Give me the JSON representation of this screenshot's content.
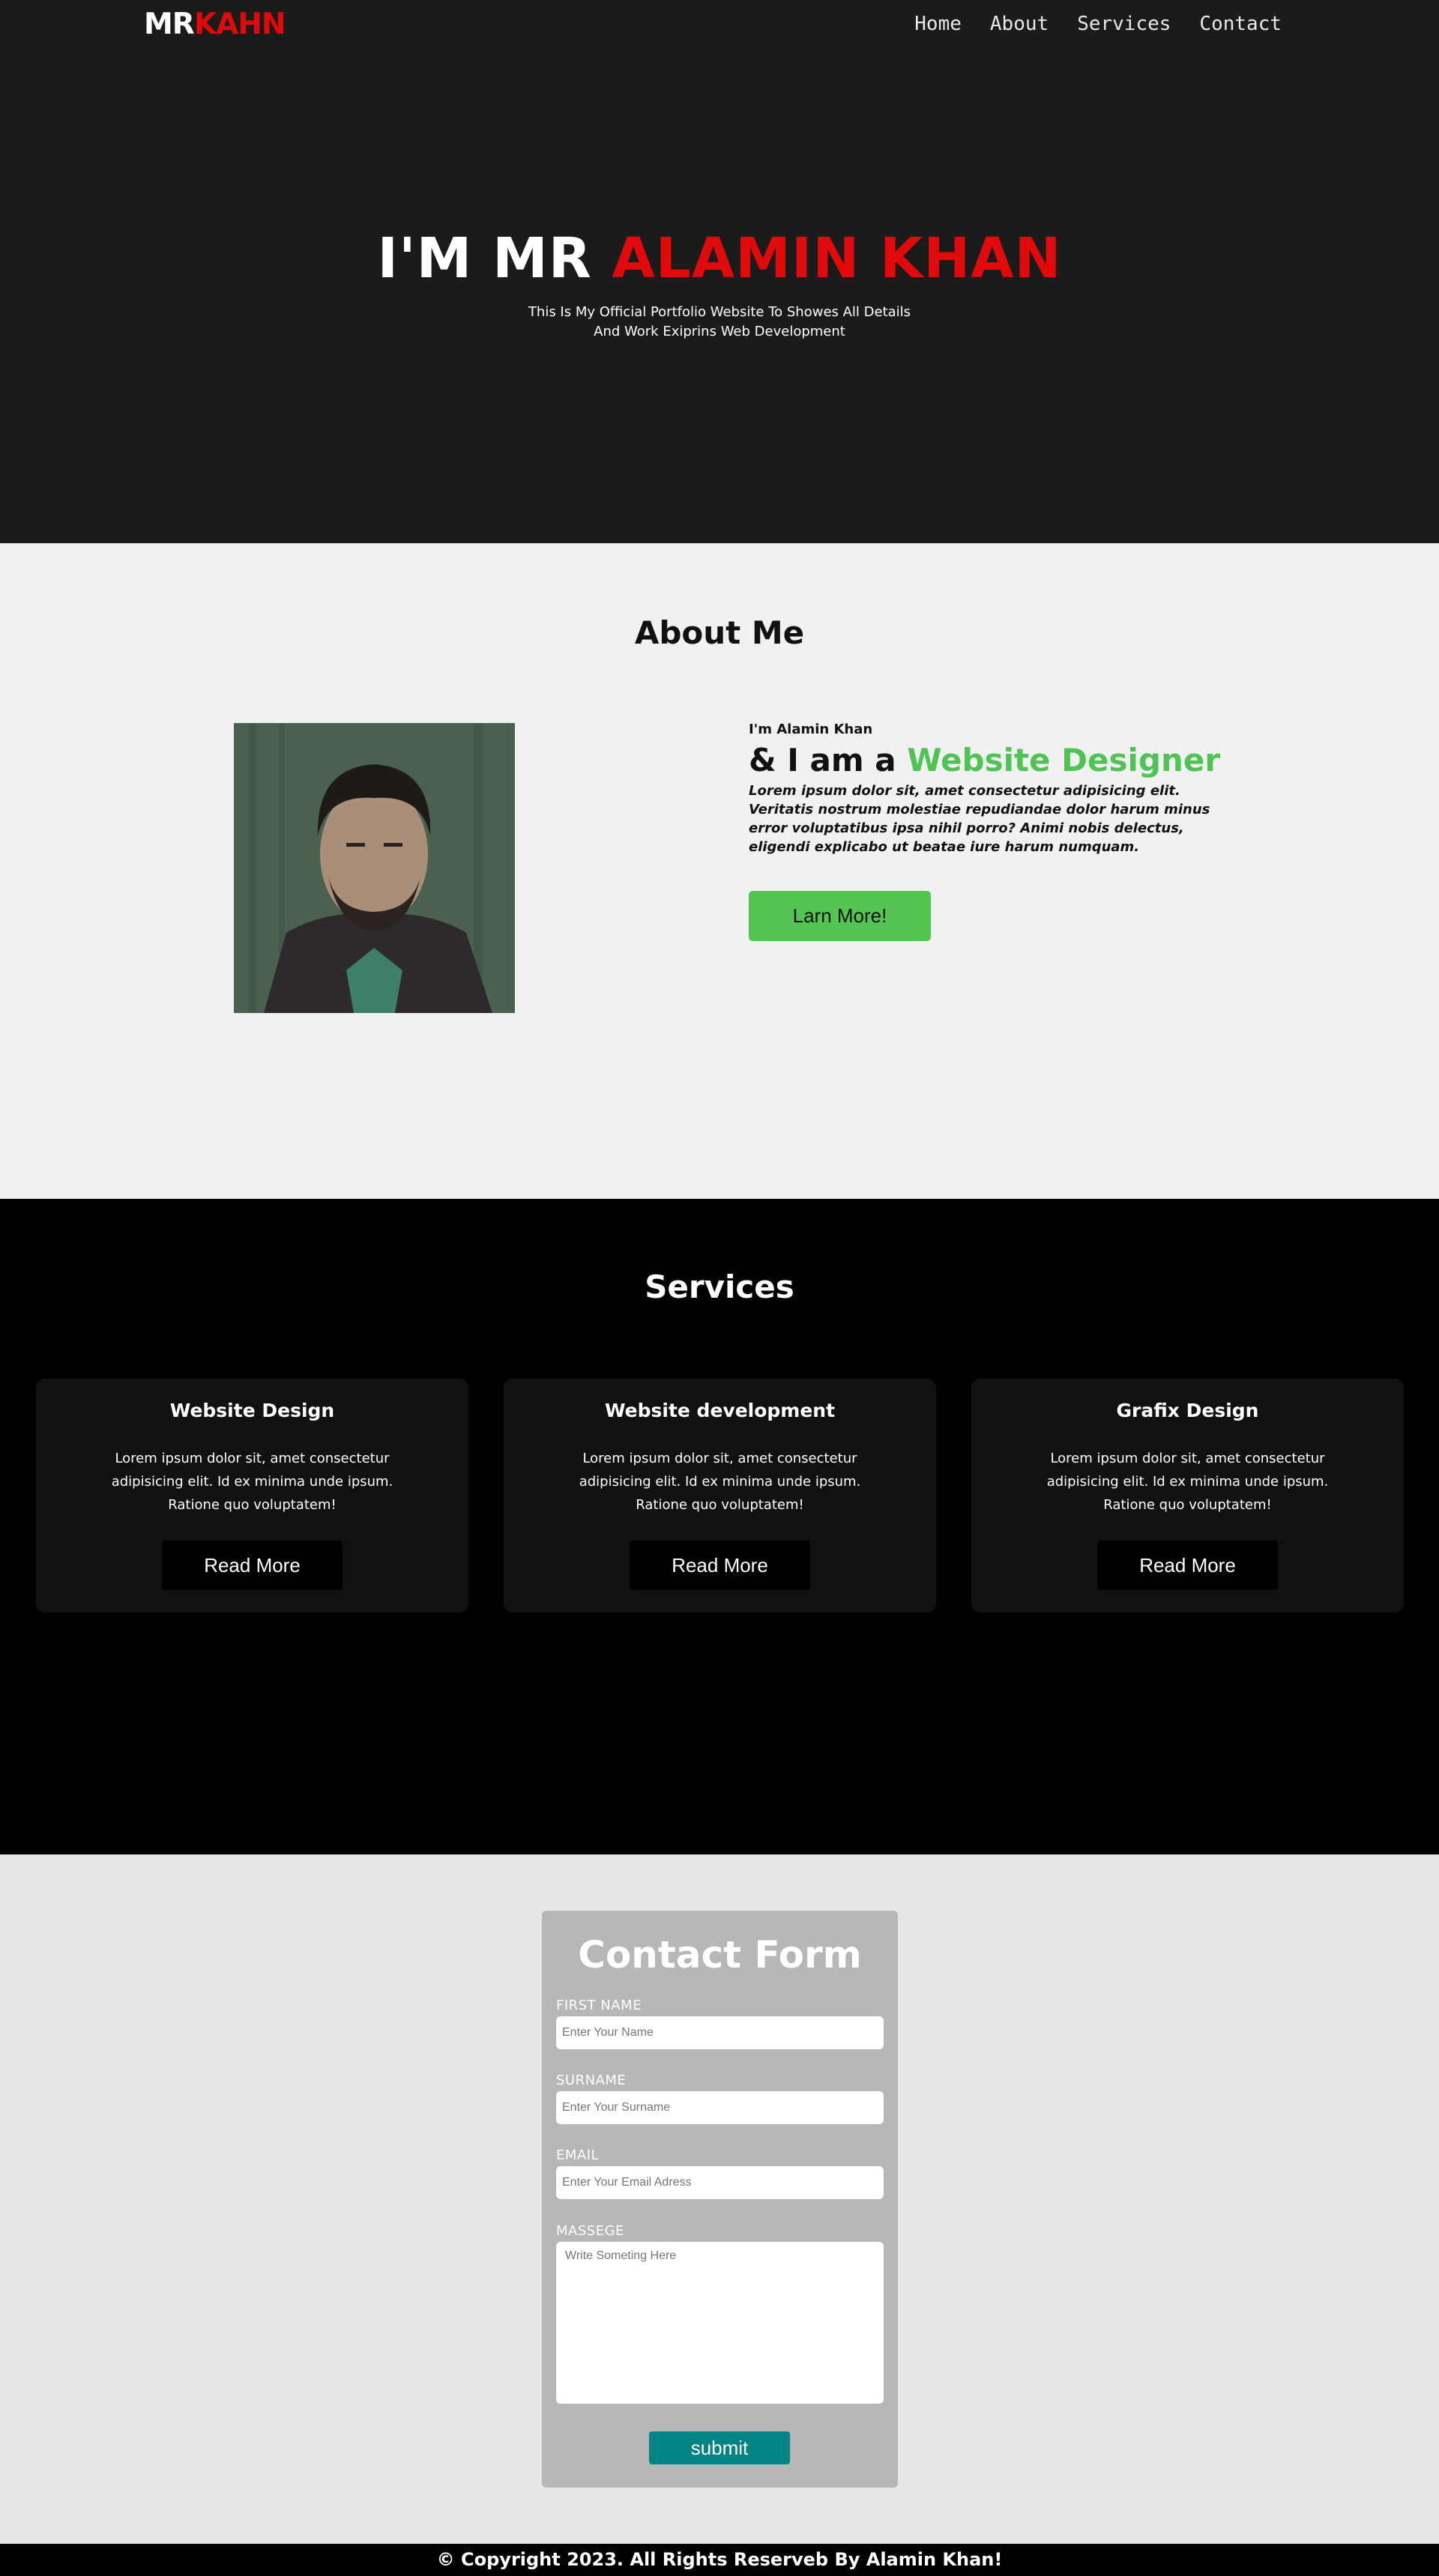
{
  "nav": {
    "logo_prefix": "MR",
    "logo_suffix": "KAHN",
    "links": [
      "Home",
      "About",
      "Services",
      "Contact"
    ]
  },
  "hero": {
    "title_white": "I'M MR",
    "title_red": "ALAMIN KHAN",
    "subtitle": "This Is My Official Portfolio Website To Showes All Details And Work Exiprins Web Development"
  },
  "about": {
    "heading": "About Me",
    "small": "I'm Alamin Khan",
    "big_prefix": "& I am a",
    "big_highlight": "Website Designer",
    "paragraph": "Lorem ipsum dolor sit, amet consectetur adipisicing elit. Veritatis nostrum molestiae repudiandae dolor harum minus error voluptatibus ipsa nihil porro? Animi nobis delectus, eligendi explicabo ut beatae iure harum numquam.",
    "button": "Larn More!"
  },
  "services": {
    "heading": "Services",
    "cards": [
      {
        "title": "Website Design",
        "text": "Lorem ipsum dolor sit, amet consectetur adipisicing elit. Id ex minima unde ipsum. Ratione quo voluptatem!",
        "button": "Read More"
      },
      {
        "title": "Website development",
        "text": "Lorem ipsum dolor sit, amet consectetur adipisicing elit. Id ex minima unde ipsum. Ratione quo voluptatem!",
        "button": "Read More"
      },
      {
        "title": "Grafix Design",
        "text": "Lorem ipsum dolor sit, amet consectetur adipisicing elit. Id ex minima unde ipsum. Ratione quo voluptatem!",
        "button": "Read More"
      }
    ]
  },
  "contact": {
    "heading": "Contact Form",
    "first_label": "FIRST NAME",
    "first_placeholder": "Enter Your Name",
    "surname_label": "SURNAME",
    "surname_placeholder": "Enter Your Surname",
    "email_label": "EMAIL",
    "email_placeholder": "Enter Your Email Adress",
    "message_label": "MASSEGE",
    "message_placeholder": "Write Someting Here",
    "submit": "submit"
  },
  "footer": {
    "text": "© Copyright 2023. All Rights Reserveb By Alamin Khan!"
  },
  "colors": {
    "accent_red": "#e0090b",
    "accent_green": "#52c552",
    "submit_teal": "#038383"
  }
}
